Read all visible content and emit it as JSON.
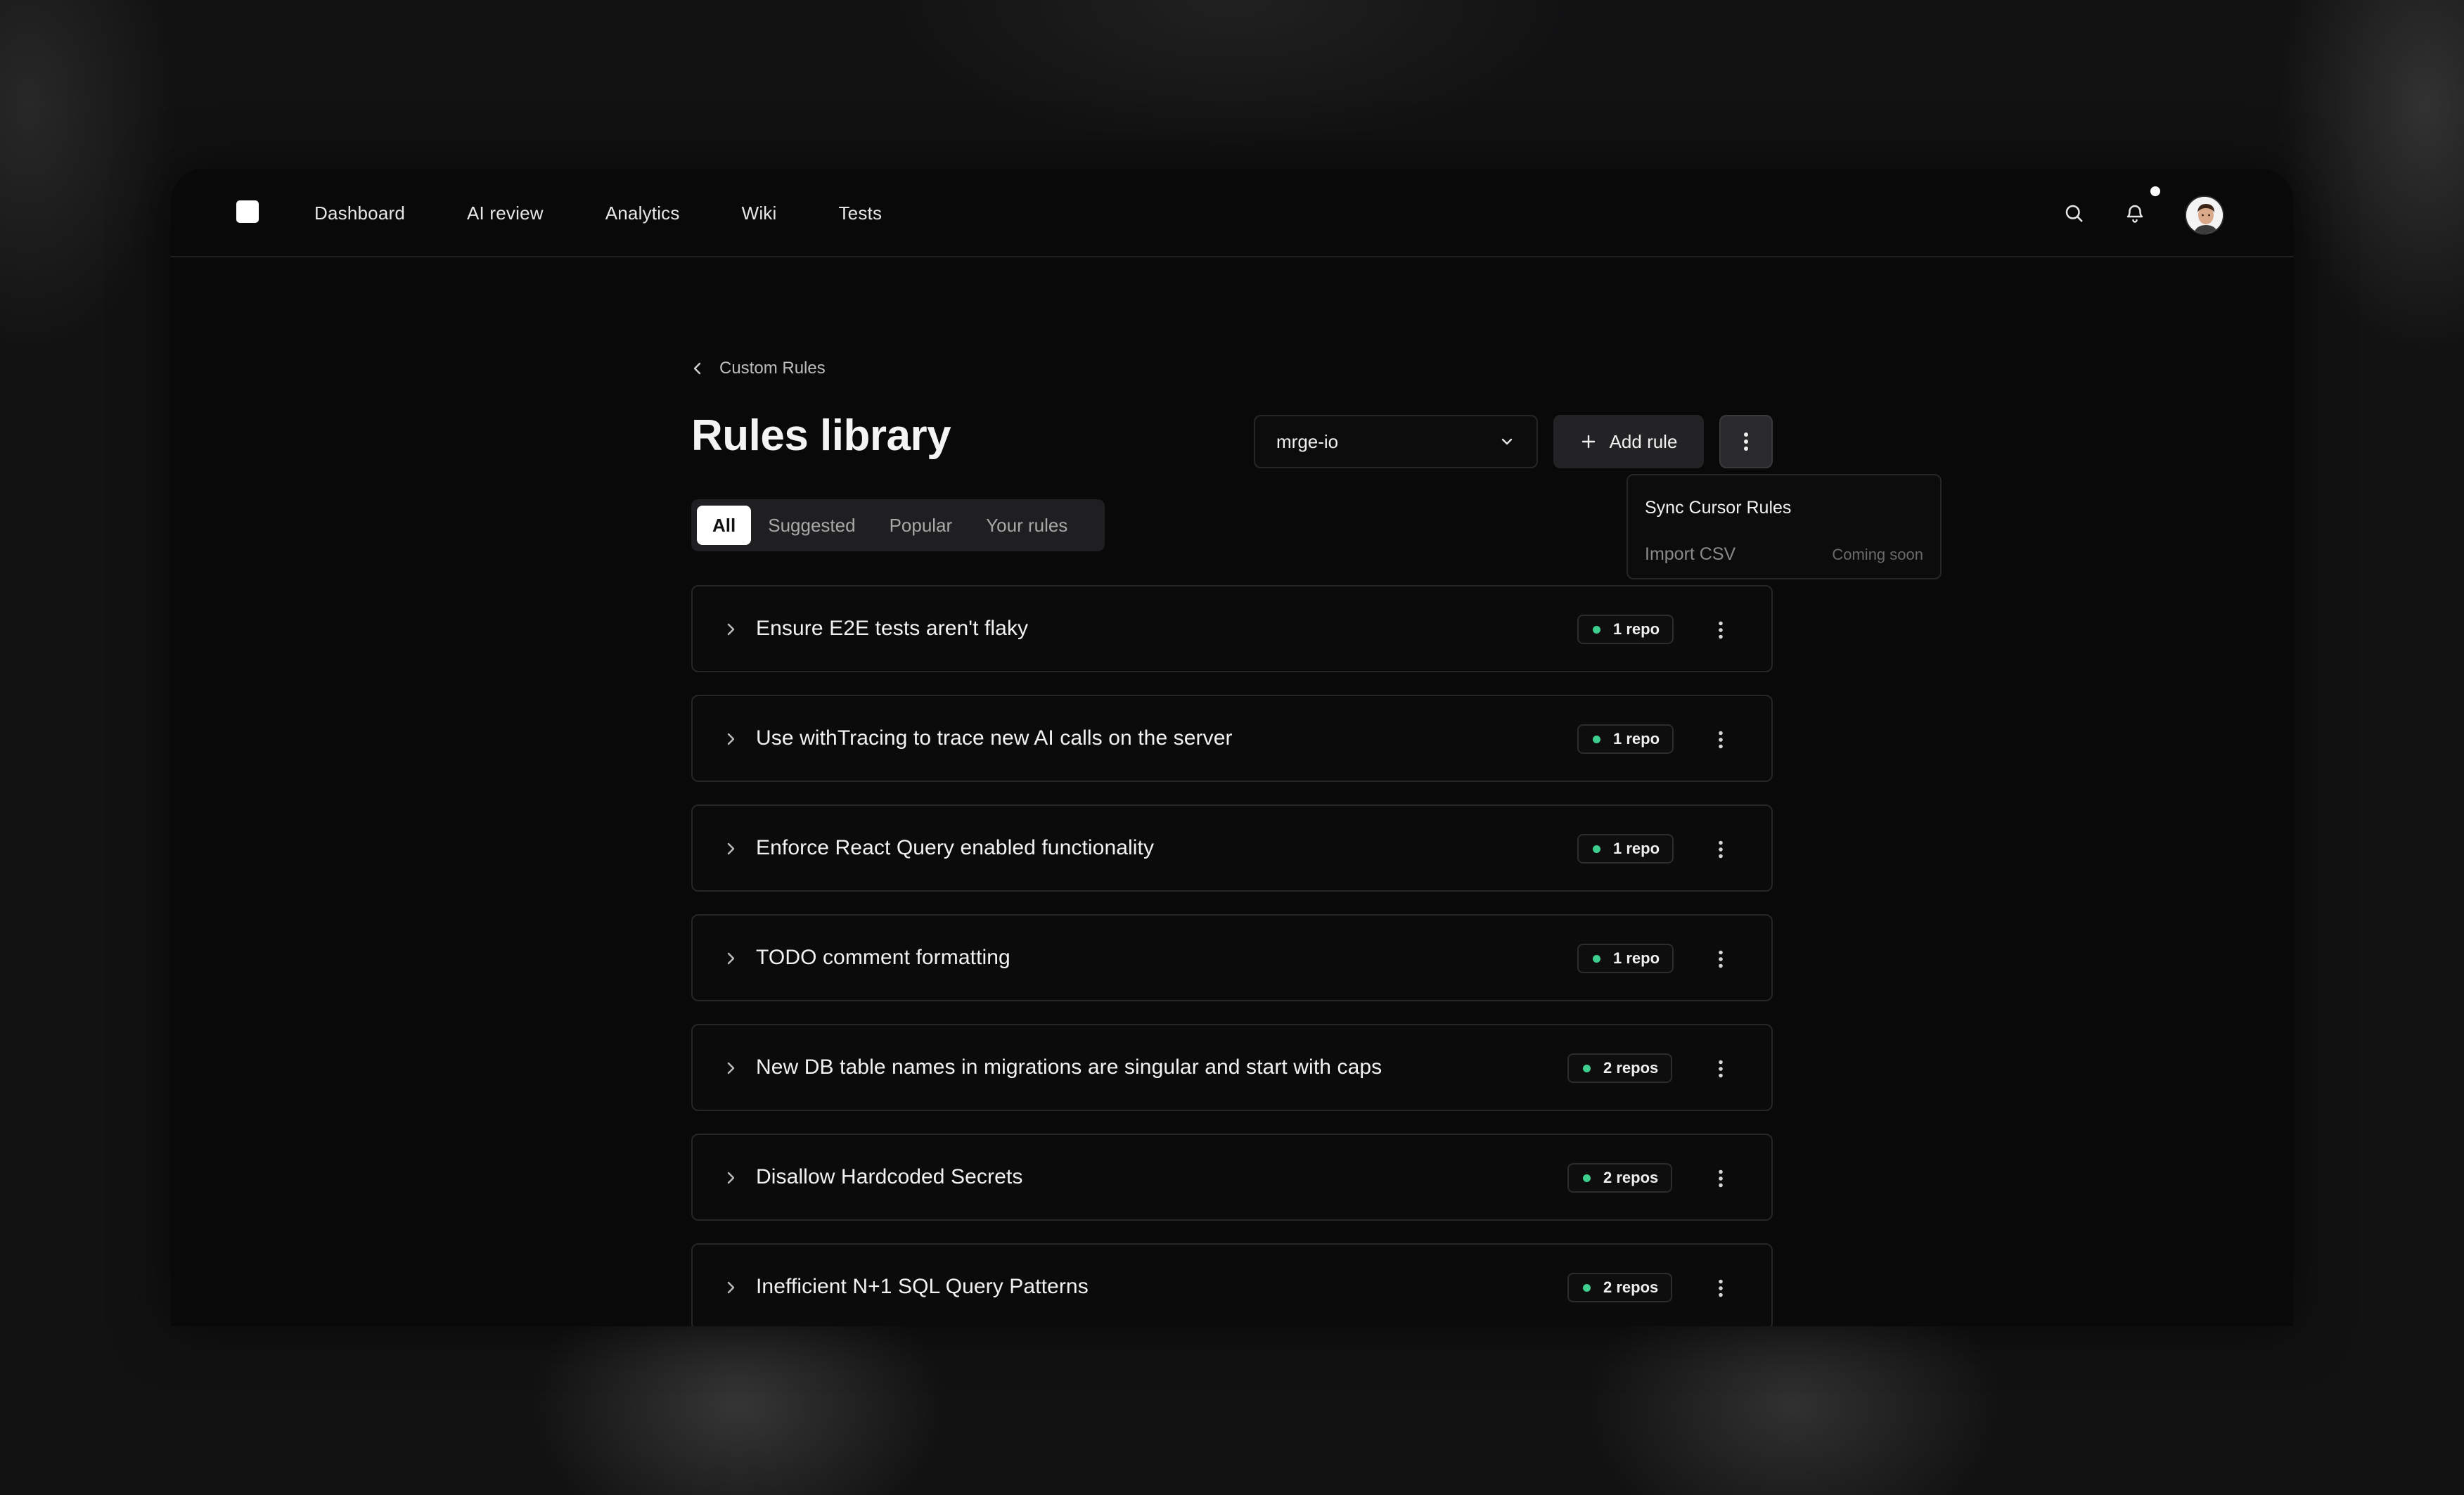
{
  "nav": {
    "items": [
      {
        "label": "Dashboard"
      },
      {
        "label": "AI review"
      },
      {
        "label": "Analytics"
      },
      {
        "label": "Wiki"
      },
      {
        "label": "Tests"
      }
    ]
  },
  "breadcrumb": {
    "label": "Custom Rules"
  },
  "page": {
    "title": "Rules library"
  },
  "org_select": {
    "value": "mrge-io"
  },
  "add_rule": {
    "label": "Add rule"
  },
  "menu": {
    "items": [
      {
        "label": "Sync Cursor Rules"
      },
      {
        "label": "Import CSV",
        "note": "Coming soon"
      }
    ]
  },
  "tabs": [
    {
      "label": "All",
      "active": true
    },
    {
      "label": "Suggested"
    },
    {
      "label": "Popular"
    },
    {
      "label": "Your rules"
    }
  ],
  "rules": [
    {
      "title": "Ensure E2E tests aren't flaky",
      "repos": "1 repo"
    },
    {
      "title": "Use withTracing to trace new AI calls on the server",
      "repos": "1 repo"
    },
    {
      "title": "Enforce React Query enabled functionality",
      "repos": "1 repo"
    },
    {
      "title": "TODO comment formatting",
      "repos": "1 repo"
    },
    {
      "title": "New DB table names in migrations are singular and start with caps",
      "repos": "2 repos"
    },
    {
      "title": "Disallow Hardcoded Secrets",
      "repos": "2 repos"
    },
    {
      "title": "Inefficient N+1 SQL Query Patterns",
      "repos": "2 repos"
    }
  ],
  "colors": {
    "status_dot": "#3ecf8e",
    "accent": "#ffffff"
  },
  "icons": [
    "logo-icon",
    "search-icon",
    "bell-icon",
    "chevron-left-icon",
    "chevron-down-icon",
    "plus-icon",
    "more-vertical-icon",
    "chevron-right-icon"
  ]
}
